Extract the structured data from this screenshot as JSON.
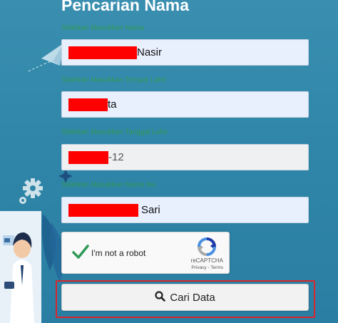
{
  "page": {
    "title": "Pencarian Nama"
  },
  "form": {
    "fields": [
      {
        "label": "Silahkan Masukkan Nama",
        "value_visible": "Nasir"
      },
      {
        "label": "Silahkan Masukkan Tempat Lahir",
        "value_visible": "ta"
      },
      {
        "label": "Silahkan Masukkan Tanggal Lahir",
        "value_visible": "-12"
      },
      {
        "label": "Silahkan Masukkan Nama Ibu",
        "value_visible": "Sari"
      }
    ],
    "captcha": {
      "label": "I'm not a robot",
      "brand": "reCAPTCHA",
      "links": "Privacy - Terms",
      "checked": true
    },
    "submit_label": "Cari Data"
  },
  "colors": {
    "background": "#2f86a8",
    "label_text": "#2e9a57",
    "checkmark": "#2e9a57",
    "highlight_border": "#d9262c",
    "redaction": "#ff0000"
  },
  "icons": [
    "paper-plane-icon",
    "gear-icon",
    "sparkle-icon",
    "check-icon",
    "recaptcha-logo-icon",
    "search-icon"
  ]
}
